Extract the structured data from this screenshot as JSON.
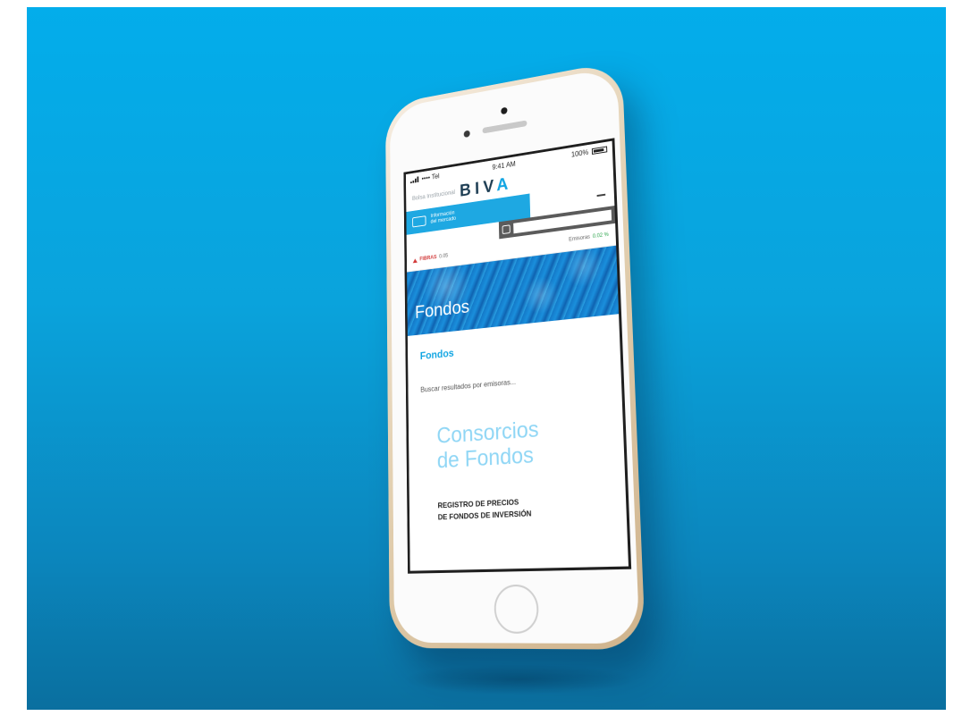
{
  "status_bar": {
    "carrier": "•••• Tel",
    "time": "9:41 AM",
    "battery": "100%"
  },
  "brand": {
    "pre_label": "Bolsa Institucional",
    "name_main": "BIV",
    "name_accent": "A"
  },
  "banner": {
    "line1": "Información",
    "line2": "del mercado"
  },
  "search": {
    "placeholder": ""
  },
  "ticker": {
    "left_label": "FIBRAS",
    "left_sub": "0.05",
    "mid_label": "Emisoras",
    "right_label": "0.02 %"
  },
  "hero": {
    "title": "Fondos"
  },
  "content": {
    "section_title": "Fondos",
    "notice": "Buscar resultados por emisoras...",
    "big_title_line1": "Consorcios",
    "big_title_line2": "de Fondos",
    "registry_line1": "REGISTRO DE PRECIOS",
    "registry_line2": "DE FONDOS DE INVERSIÓN"
  },
  "colors": {
    "background": "#03adeb",
    "accent": "#11a5e2",
    "phone_body": "#e2cfb0"
  }
}
